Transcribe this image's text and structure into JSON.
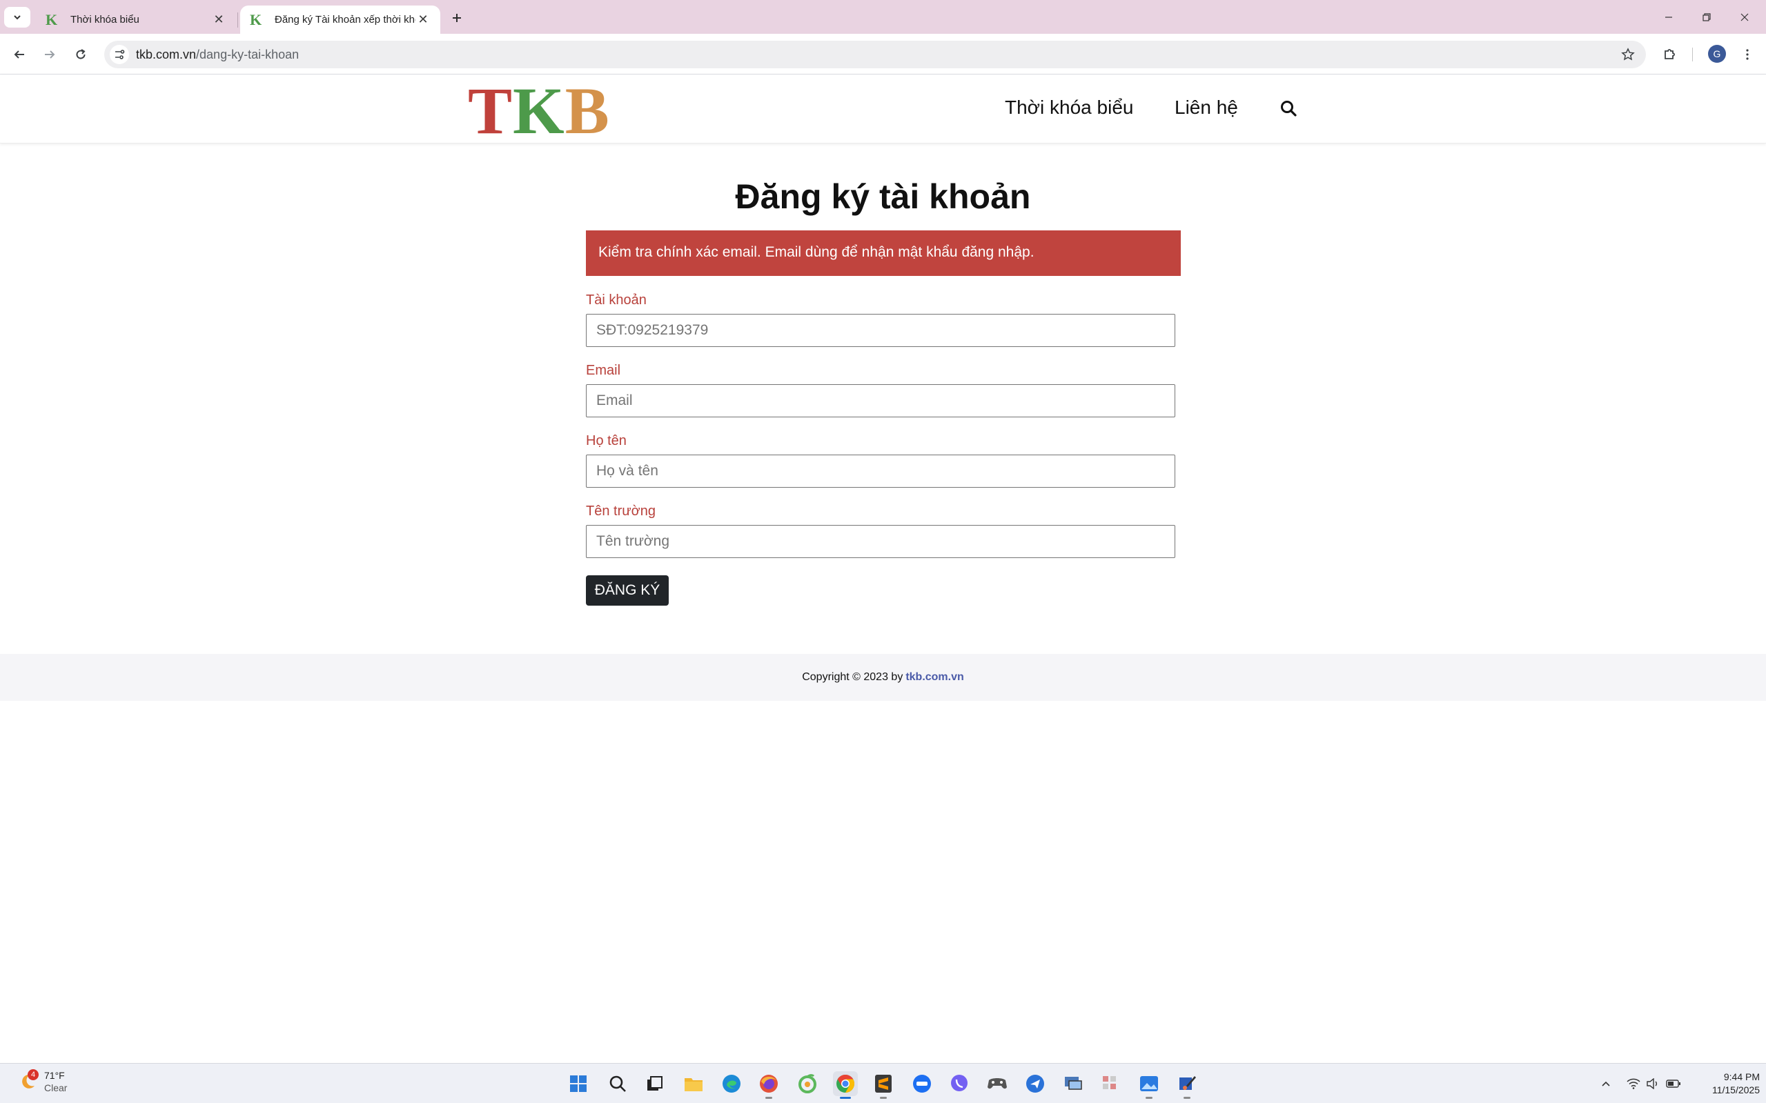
{
  "browser": {
    "tabs": [
      {
        "title": "Thời khóa biểu",
        "active": false
      },
      {
        "title": "Đăng ký Tài khoản xếp thời khóa biểu",
        "active": true
      }
    ],
    "url_host": "tkb.com.vn",
    "url_path": "/dang-ky-tai-khoan",
    "profile_initial": "G"
  },
  "site": {
    "logo": {
      "letters": [
        "T",
        "K",
        "B"
      ],
      "colors": [
        "#c0413b",
        "#4d9a4a",
        "#d4924b"
      ]
    },
    "nav": [
      {
        "label": "Thời khóa biểu"
      },
      {
        "label": "Liên hệ"
      }
    ]
  },
  "form": {
    "title": "Đăng ký tài khoản",
    "alert": "Kiểm tra chính xác email. Email dùng để nhận mật khẩu đăng nhập.",
    "fields": [
      {
        "label": "Tài khoản",
        "value": "",
        "placeholder": "SĐT:0925219379"
      },
      {
        "label": "Email",
        "value": "",
        "placeholder": "Email"
      },
      {
        "label": "Họ tên",
        "value": "",
        "placeholder": "Họ và tên"
      },
      {
        "label": "Tên trường",
        "value": "",
        "placeholder": "Tên trường"
      }
    ],
    "submit_label": "ĐĂNG KÝ"
  },
  "footer": {
    "text": "Copyright © 2023 by",
    "link": "tkb.com.vn"
  },
  "taskbar": {
    "weather": {
      "temp": "71°F",
      "condition": "Clear",
      "badge": "4"
    },
    "time": "9:44 PM",
    "date": "11/15/2025"
  },
  "colors": {
    "tabbar": "#e9d3e1",
    "label": "#b8413b",
    "alert_bg": "#c0443e",
    "button_bg": "#212529",
    "footer_link": "#4a5aa8"
  }
}
